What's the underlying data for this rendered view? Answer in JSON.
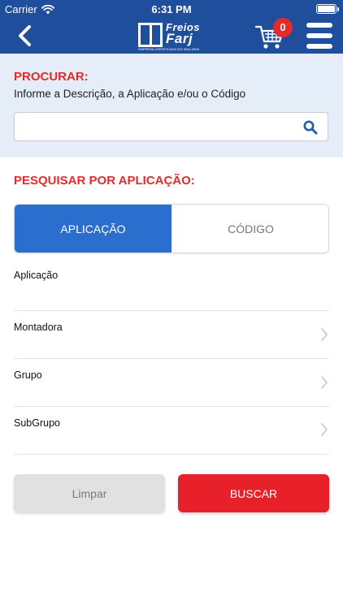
{
  "status_bar": {
    "carrier": "Carrier",
    "time": "6:31 PM",
    "battery_level": 1.0
  },
  "navbar": {
    "back_icon": "chevron-left-icon",
    "logo": {
      "brand_top": "Freios",
      "brand_main": "Farj",
      "tagline": "EMPRESA CERTIFICADA ISO 9001:2008"
    },
    "cart": {
      "icon": "cart-icon",
      "count": "0"
    },
    "menu_icon": "hamburger-menu-icon"
  },
  "search": {
    "title": "PROCURAR:",
    "hint": "Informe a Descrição, a Aplicação e/ou o Código",
    "value": "",
    "placeholder": ""
  },
  "filter": {
    "title": "PESQUISAR POR APLICAÇÃO:",
    "tabs": [
      {
        "label": "APLICAÇÃO",
        "active": true
      },
      {
        "label": "CÓDIGO",
        "active": false
      }
    ],
    "fields": [
      {
        "label": "Aplicação"
      },
      {
        "label": "Montadora"
      },
      {
        "label": "Grupo"
      },
      {
        "label": "SubGrupo"
      }
    ]
  },
  "actions": {
    "clear_label": "Limpar",
    "search_label": "BUSCAR"
  },
  "colors": {
    "header": "#1f4e9c",
    "accent_red": "#e32b2b",
    "tab_active": "#2a6fce",
    "search_bg": "#e4edf8"
  }
}
